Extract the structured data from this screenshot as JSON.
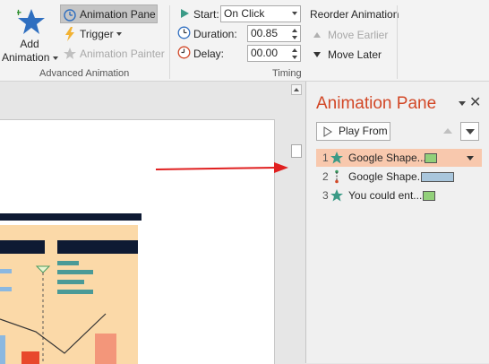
{
  "ribbon": {
    "add_animation": {
      "line1": "Add",
      "line2": "Animation"
    },
    "animation_pane_label": "Animation Pane",
    "trigger_label": "Trigger",
    "animation_painter_label": "Animation Painter",
    "advanced_group_label": "Advanced Animation",
    "start": {
      "label": "Start:",
      "value": "On Click"
    },
    "duration": {
      "label": "Duration:",
      "value": "00.85"
    },
    "delay": {
      "label": "Delay:",
      "value": "00.00"
    },
    "timing_group_label": "Timing",
    "reorder_title": "Reorder Animation",
    "move_earlier_label": "Move Earlier",
    "move_later_label": "Move Later"
  },
  "pane": {
    "title": "Animation Pane",
    "play_from_label": "Play From",
    "items": [
      {
        "index": "1",
        "name": "Google Shape...",
        "swatch": "#92d07a",
        "selected": true,
        "icon": "star-icon"
      },
      {
        "index": "2",
        "name": "Google Shape...",
        "swatch": "#a9c6dc",
        "selected": false,
        "icon": "motion-path-icon"
      },
      {
        "index": "3",
        "name": "You could ent...",
        "swatch": "#92d07a",
        "selected": false,
        "icon": "star-icon"
      }
    ]
  },
  "colors": {
    "accent": "#d24726",
    "star": "#3a9a86",
    "slide_bg": "#fbd9a8",
    "slide_dark": "#0e1a33",
    "arrow": "#e02020"
  }
}
